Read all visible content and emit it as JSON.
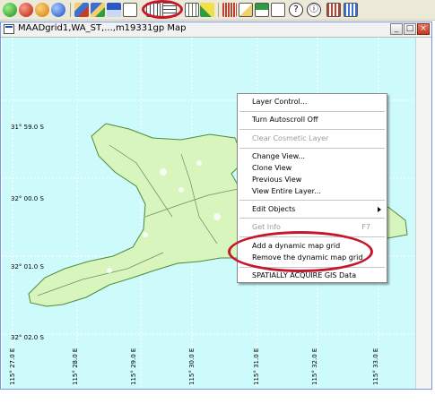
{
  "toolbar": {
    "buttons": [
      {
        "icon": "green-globe-icon"
      },
      {
        "icon": "red-globe-icon"
      },
      {
        "icon": "orange-globe-icon"
      },
      {
        "icon": "blue-globe-icon"
      },
      {
        "icon": "layer-stack-icon"
      },
      {
        "icon": "layer-edit-icon"
      },
      {
        "icon": "layer-grid-icon"
      },
      {
        "icon": "select-arrow-icon"
      },
      {
        "icon": "add-grid-icon"
      },
      {
        "icon": "remove-grid-icon"
      },
      {
        "icon": "grid-settings-icon"
      },
      {
        "icon": "ruler-icon"
      },
      {
        "icon": "bar-chart-icon"
      },
      {
        "icon": "edit-layer-icon"
      },
      {
        "icon": "save-layer-icon"
      },
      {
        "icon": "link-icon"
      },
      {
        "icon": "help-icon"
      },
      {
        "icon": "about-icon"
      },
      {
        "icon": "grid-color-icon"
      },
      {
        "icon": "grid-options-icon"
      }
    ],
    "colors": {
      "highlight": "#c4172c"
    }
  },
  "window": {
    "title": "MAADgrid1,WA_ST,...,m19331gp Map",
    "minimize_label": "_",
    "maximize_label": "□",
    "close_label": "×"
  },
  "map": {
    "colors": {
      "sea": "#cdfbfb",
      "land": "#d8f5bd",
      "grid": "#ffffff",
      "border": "#4e8a3a"
    },
    "lat_labels": [
      "31° 59.0 S",
      "32° 00.0 S",
      "32° 01.0 S",
      "32° 02.0 S"
    ],
    "lon_labels": [
      "115° 27.0 E",
      "115° 28.0 E",
      "115° 29.0 E",
      "115° 30.0 E",
      "115° 31.0 E",
      "115° 32.0 E",
      "115° 33.0 E"
    ]
  },
  "context_menu": {
    "items": [
      {
        "label": "Layer Control...",
        "disabled": false
      },
      {
        "label": "Turn Autoscroll Off",
        "disabled": false
      },
      {
        "label": "Clear Cosmetic Layer",
        "disabled": true
      },
      {
        "label": "Change View...",
        "disabled": false
      },
      {
        "label": "Clone View",
        "disabled": false
      },
      {
        "label": "Previous View",
        "disabled": false
      },
      {
        "label": "View Entire Layer...",
        "disabled": false
      },
      {
        "label": "Edit Objects",
        "disabled": false
      },
      {
        "label": "Get Info",
        "disabled": true,
        "shortcut": "F7"
      },
      {
        "label": "Add a dynamic map grid",
        "disabled": false
      },
      {
        "label": "Remove the dynamic map grid",
        "disabled": false
      },
      {
        "label": "SPATIALLY ACQUIRE GIS Data",
        "disabled": false
      }
    ]
  }
}
